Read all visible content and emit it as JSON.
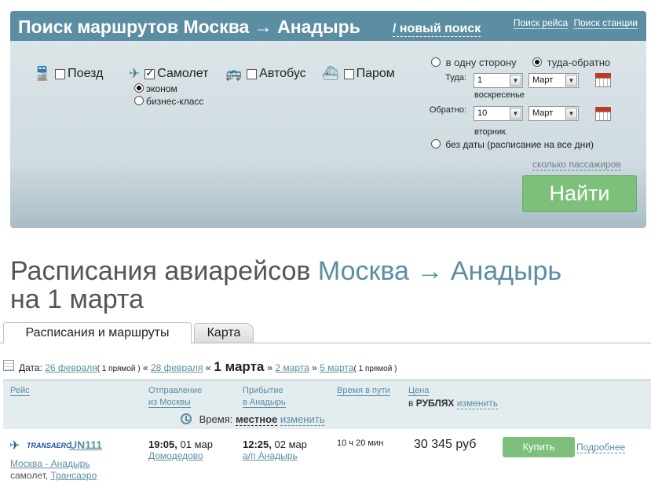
{
  "search": {
    "title": "Поиск маршрутов Москва → Анадырь",
    "new_search": "/ новый поиск",
    "top_links": [
      "Поиск рейса",
      "Поиск станции"
    ],
    "transport": {
      "train": "Поезд",
      "plane": "Самолет",
      "bus": "Автобус",
      "ferry": "Паром"
    },
    "class_options": {
      "economy": "эконом",
      "business": "бизнес-класс"
    },
    "trip": {
      "oneway": "в одну сторону",
      "round": "туда-обратно"
    },
    "depart": {
      "label": "Туда:",
      "day": "1",
      "month": "Март",
      "weekday": "воскресенье"
    },
    "return": {
      "label": "Обратно:",
      "day": "10",
      "month": "Март",
      "weekday": "вторник"
    },
    "no_date": "без даты (расписание на все дни)",
    "passengers": "сколько пассажиров",
    "find": "Найти"
  },
  "heading": {
    "prefix": "Расписания авиарейсов ",
    "route": "Москва → Анадырь",
    "date_line": "на 1 марта"
  },
  "tabs": {
    "schedule": "Расписания и маршруты",
    "map": "Карта"
  },
  "date_nav": {
    "label": "Дата:",
    "prev2": "26 февраля",
    "prev2_note": "( 1 прямой )",
    "prev1": "28 февраля",
    "current": "1 марта",
    "next1": "2 марта",
    "next2": "5 марта",
    "next2_note": "( 1 прямой )",
    "left_arrows": "«",
    "right_arrows": "»"
  },
  "table_head": {
    "flight": "Рейс",
    "depart_1": "Отправление",
    "depart_2": "из Москвы",
    "arrive_1": "Прибытие",
    "arrive_2": "в Анадырь",
    "travel_time": "Время в пути",
    "price": "Цена",
    "price_in": "в",
    "currency": "РУБЛЯХ",
    "change": "изменить",
    "time_label": "Время:",
    "time_mode": "местное",
    "time_change": "изменить"
  },
  "flight": {
    "airline_logo": "TRANSAERO",
    "number": "UN111",
    "route": "Москва - Анадырь",
    "type": "самолет,",
    "airline": "Трансаэро",
    "dep_time": "19:05,",
    "dep_date": "01 мар",
    "dep_airport": "Домодедово",
    "arr_time": "12:25,",
    "arr_date": "02 мар",
    "arr_airport": "а/п Анадырь",
    "duration": "10 ч 20 мин",
    "price": "30 345 руб",
    "buy": "Купить",
    "details": "Подробнее"
  },
  "colors": {
    "accent": "#5b8ea3",
    "button": "#7dc07b"
  }
}
